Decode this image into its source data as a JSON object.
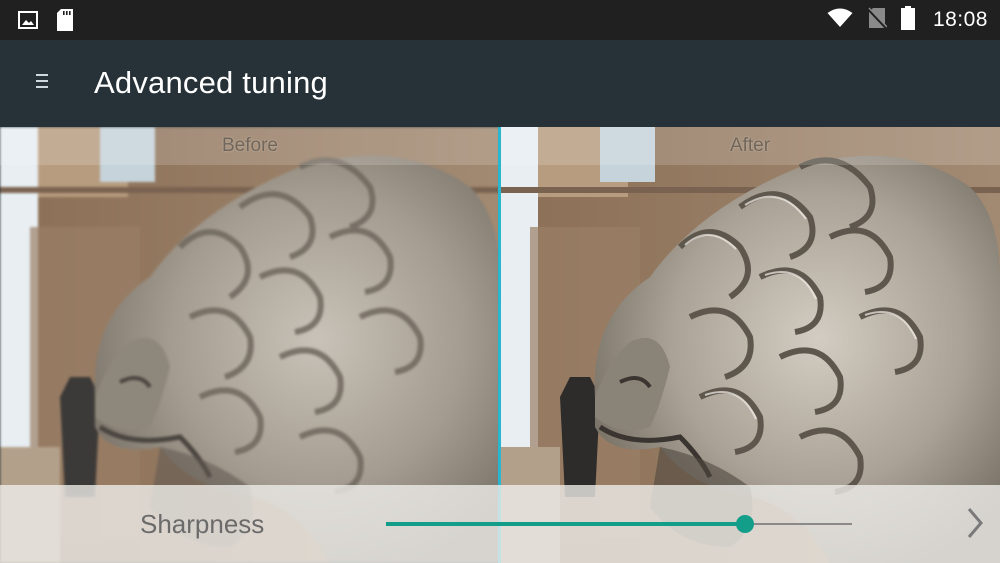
{
  "status_bar": {
    "left_icons": [
      "image-notification-icon",
      "sd-card-icon"
    ],
    "right_icons": [
      "wifi-icon",
      "no-sim-icon",
      "battery-icon"
    ],
    "time": "18:08"
  },
  "app_bar": {
    "menu_icon": "menu-icon",
    "title": "Advanced tuning"
  },
  "comparison": {
    "before_label": "Before",
    "after_label": "After",
    "divider_color": "#29b6cf"
  },
  "controls": {
    "parameter_label": "Sharpness",
    "slider_value_fraction": 0.77,
    "accent_color": "#139e8a",
    "next_icon": "chevron-right-icon"
  }
}
